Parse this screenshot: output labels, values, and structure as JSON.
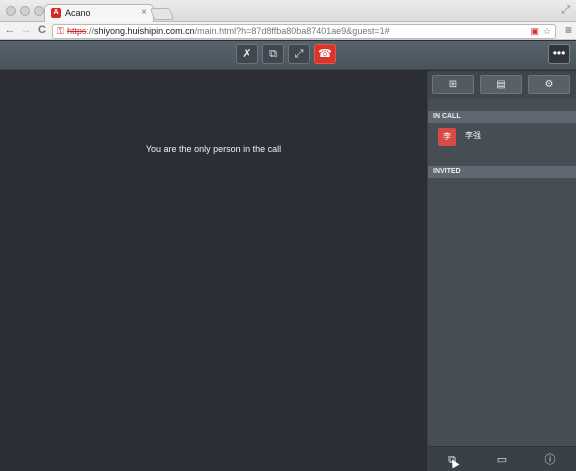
{
  "browser": {
    "tab_title": "Acano",
    "tab_favicon": "A",
    "tab_close": "×",
    "url_scheme": "https",
    "url_rest_host": "shiyong.huishipin.com.cn",
    "url_path": "/main.html?h=87d8ffba80ba87401ae9&guest=1#",
    "back_glyph": "←",
    "forward_glyph": "→",
    "reload_glyph": "C",
    "menu_glyph": "≡",
    "star_glyph": "☆",
    "lock_glyph": "⚿",
    "blocked_glyph": "▣",
    "fullscreen_glyph": "⤢"
  },
  "call_controls": {
    "mute_glyph": "✗",
    "layout_glyph": "⧉",
    "fullscreen_glyph": "⤢",
    "end_glyph": "☎",
    "more_glyph": "•••"
  },
  "stage": {
    "message": "You are the only person in the call"
  },
  "panel": {
    "tabs": [
      {
        "icon": "participants-icon",
        "glyph": "⊞"
      },
      {
        "icon": "document-icon",
        "glyph": "▤"
      },
      {
        "icon": "settings-icon",
        "glyph": "⚙"
      }
    ],
    "in_call_label": "IN CALL",
    "invited_label": "INVITED",
    "participant": {
      "avatar": "李",
      "name": "李强"
    },
    "footer": [
      {
        "icon": "participants-list-icon",
        "glyph": "⧉"
      },
      {
        "icon": "chat-icon",
        "glyph": "▭"
      },
      {
        "icon": "info-icon",
        "glyph": "ⓘ"
      }
    ]
  },
  "colors": {
    "accent_end": "#d8342a",
    "panel_bg": "#464d55",
    "stage_bg": "#2b2f35"
  }
}
